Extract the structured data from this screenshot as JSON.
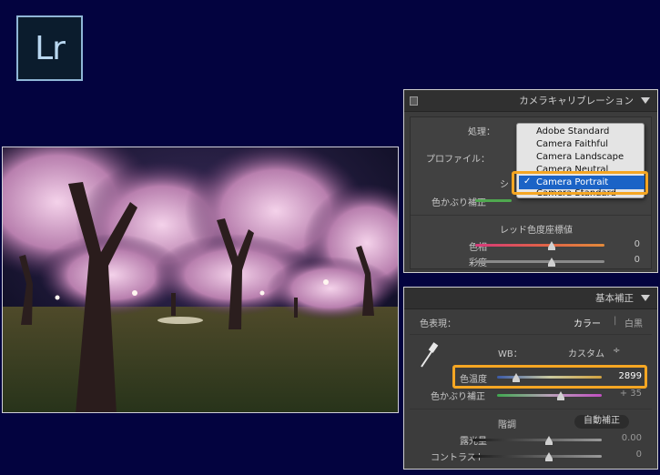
{
  "app": {
    "logo_text": "Lr"
  },
  "calibration": {
    "title": "カメラキャリブレーション",
    "process_label": "処理：",
    "profile_label": "プロファイル：",
    "shadow_label_partial": "シ",
    "tint_label": "色かぶり補正",
    "red_primary_label": "レッド色度座標値",
    "hue_label": "色相",
    "hue_value": "0",
    "saturation_label": "彩度",
    "saturation_value": "0",
    "profile_options": [
      "Adobe Standard",
      "Camera Faithful",
      "Camera Landscape",
      "Camera Neutral",
      "Camera Portrait",
      "Camera Standard"
    ],
    "selected_profile": "Camera Portrait",
    "check_mark": "✓"
  },
  "basic": {
    "title": "基本補正",
    "treatment_label": "色表現：",
    "treatment_color": "カラー",
    "treatment_separator": "|",
    "treatment_bw": "白黒",
    "wb_label": "WB：",
    "wb_value": "カスタム",
    "wb_arrows": "÷",
    "temp_label": "色温度",
    "temp_value": "2899",
    "temp_fraction": 0.18,
    "tint_label": "色かぶり補正",
    "tint_value": "+ 35",
    "tone_label": "階調",
    "auto_button": "自動補正",
    "exposure_label": "露光量",
    "exposure_value": "0.00",
    "contrast_label": "コントラスト",
    "contrast_value": "0"
  },
  "colors": {
    "background": "#03033f",
    "highlight": "#f5a623",
    "selection": "#1b63c6"
  }
}
